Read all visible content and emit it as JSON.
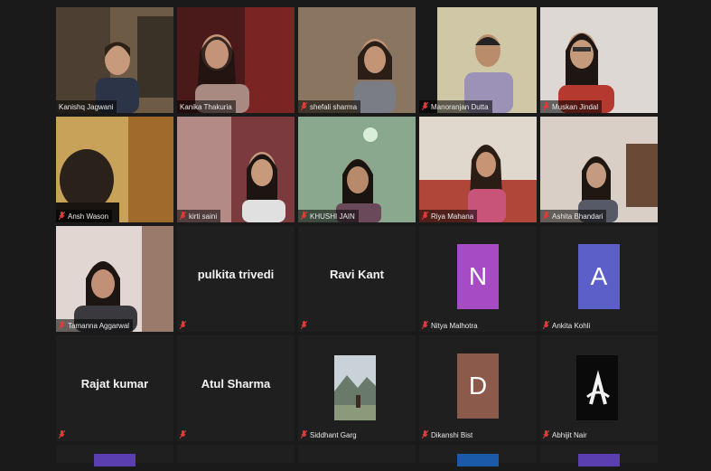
{
  "participants": [
    {
      "name": "Kanishq Jagwani",
      "initial": "",
      "color": "",
      "type": "video",
      "active": true
    },
    {
      "name": "Kanika Thakuria",
      "initial": "",
      "color": "",
      "type": "video"
    },
    {
      "name": "shefali sharma",
      "initial": "",
      "color": "",
      "type": "video"
    },
    {
      "name": "Manoranjan Dutta",
      "initial": "",
      "color": "",
      "type": "video"
    },
    {
      "name": "Muskan Jindal",
      "initial": "",
      "color": "",
      "type": "video"
    },
    {
      "name": "Ansh Wason",
      "initial": "",
      "color": "",
      "type": "video"
    },
    {
      "name": "kirti saini",
      "initial": "",
      "color": "",
      "type": "video"
    },
    {
      "name": "KHUSHI JAIN",
      "initial": "",
      "color": "",
      "type": "video"
    },
    {
      "name": "Riya Mahana",
      "initial": "",
      "color": "",
      "type": "video"
    },
    {
      "name": "Ashita Bhandari",
      "initial": "",
      "color": "",
      "type": "video"
    },
    {
      "name": "Tamanna Aggarwal",
      "initial": "",
      "color": "",
      "type": "video"
    },
    {
      "name": "pulkita trivedi",
      "initial": "",
      "color": "",
      "type": "name"
    },
    {
      "name": "Ravi Kant",
      "initial": "",
      "color": "",
      "type": "name"
    },
    {
      "name": "Nitya Malhotra",
      "initial": "N",
      "color": "#a64bc4",
      "type": "avatar"
    },
    {
      "name": "Ankita Kohli",
      "initial": "A",
      "color": "#5b5fc7",
      "type": "avatar"
    },
    {
      "name": "Rajat kumar",
      "initial": "",
      "color": "",
      "type": "name"
    },
    {
      "name": "Atul Sharma",
      "initial": "",
      "color": "",
      "type": "name"
    },
    {
      "name": "Siddhant Garg",
      "initial": "",
      "color": "",
      "type": "photo"
    },
    {
      "name": "Dikanshi Bist",
      "initial": "D",
      "color": "#8c5a4a",
      "type": "avatar"
    },
    {
      "name": "Abhijit Nair",
      "initial": "",
      "color": "#0a0a0a",
      "type": "logo"
    }
  ],
  "colors": {
    "active_outline": "#c8e07a",
    "mute": "#e23a3a",
    "tile_bg": "#1f1f1f"
  }
}
